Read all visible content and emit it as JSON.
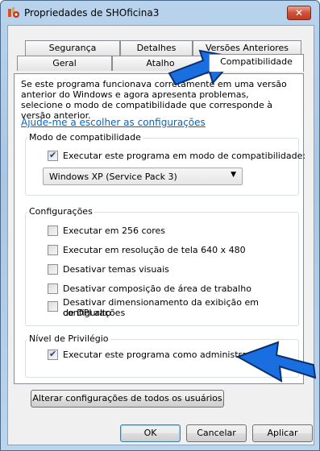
{
  "window": {
    "title": "Propriedades de SHOficina3",
    "close_label": "✕"
  },
  "tabs": {
    "row1": [
      "Segurança",
      "Detalhes",
      "Versões Anteriores"
    ],
    "row2": [
      "Geral",
      "Atalho",
      "Compatibilidade"
    ],
    "active": "Compatibilidade"
  },
  "description": "Se este programa funcionava corretamente em uma versão anterior do Windows e agora apresenta problemas, selecione o modo de compatibilidade que corresponde à versão anterior.",
  "help_link": "Ajude-me a escolher as configurações",
  "compat_mode": {
    "label": "Modo de compatibilidade",
    "checkbox_label": "Executar este programa em modo de compatibilidade:",
    "checked": true,
    "selected_os": "Windows XP (Service Pack 3)"
  },
  "settings": {
    "label": "Configurações",
    "options": [
      {
        "label": "Executar em 256 cores",
        "checked": false
      },
      {
        "label": "Executar em resolução de tela 640 x 480",
        "checked": false
      },
      {
        "label": "Desativar temas visuais",
        "checked": false
      },
      {
        "label": "Desativar composição de área de trabalho",
        "checked": false
      },
      {
        "label": "Desativar dimensionamento da exibição em configurações",
        "label2": "de DPI alto",
        "checked": false
      }
    ]
  },
  "privilege": {
    "label": "Nível de Privilégio",
    "checkbox_label": "Executar este programa como administrador",
    "checked": true
  },
  "all_users_button": "Alterar configurações de todos os usuários",
  "footer": {
    "ok": "OK",
    "cancel": "Cancelar",
    "apply": "Aplicar"
  },
  "colors": {
    "arrow_fill": "#1a6fe0",
    "link": "#0066cc"
  }
}
